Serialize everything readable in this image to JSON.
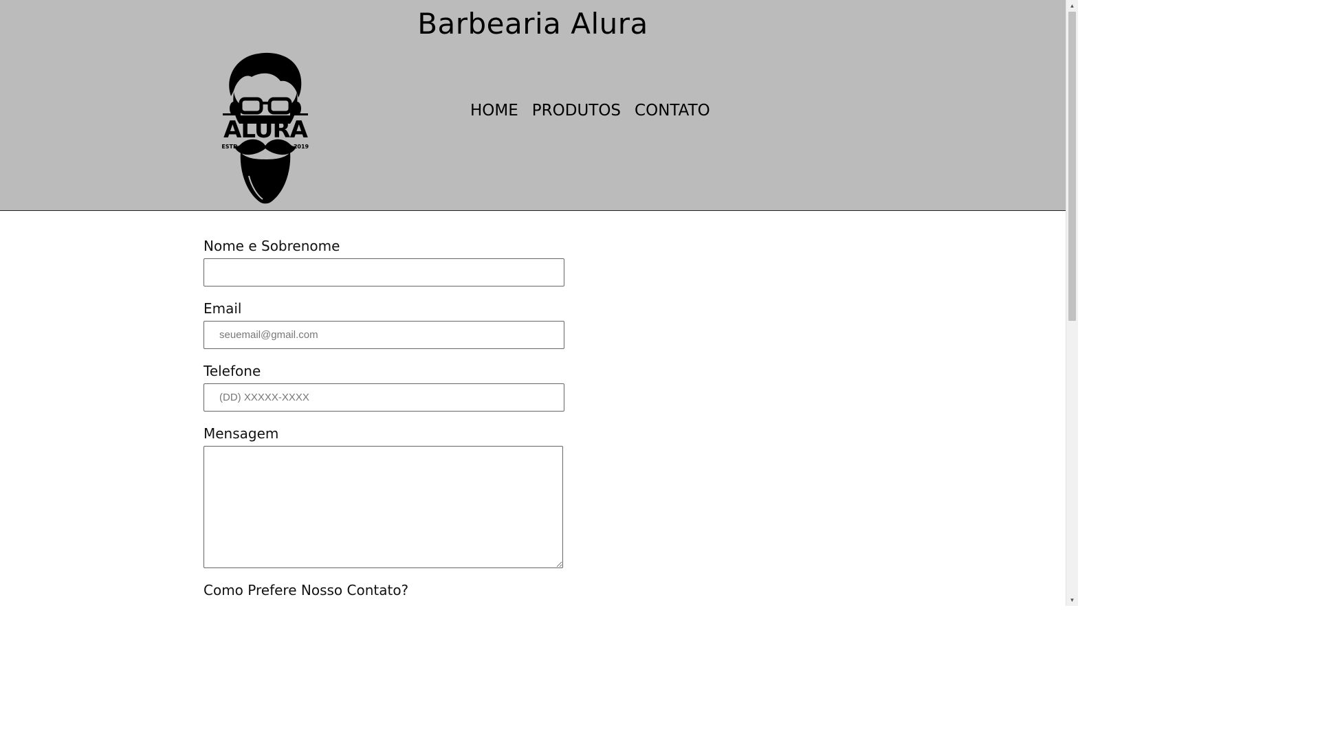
{
  "header": {
    "title": "Barbearia Alura",
    "logo": {
      "icon": "bearded-man-glasses-logo",
      "wordmark": "ALURA",
      "left_text": "ESTD",
      "right_text": "2019"
    },
    "nav": {
      "items": [
        {
          "label": "HOME"
        },
        {
          "label": "PRODUTOS"
        },
        {
          "label": "CONTATO"
        }
      ]
    }
  },
  "form": {
    "name": {
      "label": "Nome e Sobrenome",
      "placeholder": "",
      "value": ""
    },
    "email": {
      "label": "Email",
      "placeholder": "seuemail@gmail.com",
      "value": ""
    },
    "phone": {
      "label": "Telefone",
      "placeholder": "(DD) XXXXX-XXXX",
      "value": ""
    },
    "message": {
      "label": "Mensagem",
      "value": ""
    },
    "contact_preference": {
      "label": "Como Prefere Nosso Contato?"
    }
  },
  "colors": {
    "header_background": "#bbbbbb",
    "page_background": "#ffffff",
    "text": "#000000"
  }
}
